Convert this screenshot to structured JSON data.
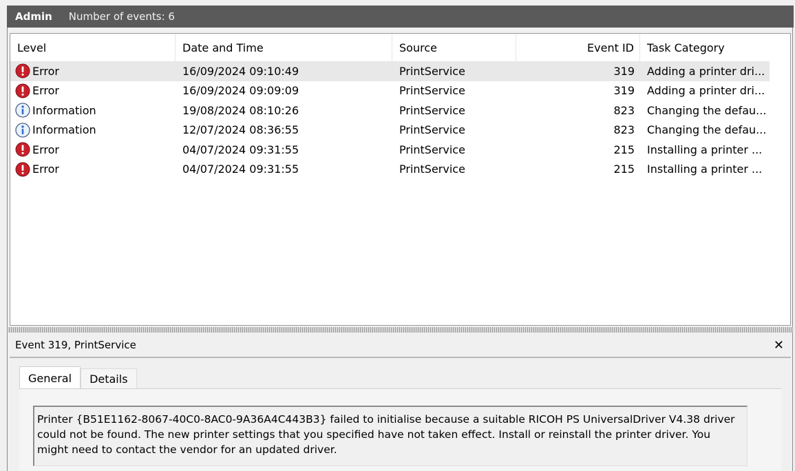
{
  "header": {
    "title": "Admin",
    "count_label": "Number of events: 6"
  },
  "columns": {
    "level": "Level",
    "date_time": "Date and Time",
    "source": "Source",
    "event_id": "Event ID",
    "task_category": "Task Category"
  },
  "events": [
    {
      "level": "Error",
      "icon": "error-icon",
      "date_time": "16/09/2024 09:10:49",
      "source": "PrintService",
      "event_id": "319",
      "task_category": "Adding a printer dri..."
    },
    {
      "level": "Error",
      "icon": "error-icon",
      "date_time": "16/09/2024 09:09:09",
      "source": "PrintService",
      "event_id": "319",
      "task_category": "Adding a printer dri..."
    },
    {
      "level": "Information",
      "icon": "information-icon",
      "date_time": "19/08/2024 08:10:26",
      "source": "PrintService",
      "event_id": "823",
      "task_category": "Changing the defau..."
    },
    {
      "level": "Information",
      "icon": "information-icon",
      "date_time": "12/07/2024 08:36:55",
      "source": "PrintService",
      "event_id": "823",
      "task_category": "Changing the defau..."
    },
    {
      "level": "Error",
      "icon": "error-icon",
      "date_time": "04/07/2024 09:31:55",
      "source": "PrintService",
      "event_id": "215",
      "task_category": "Installing a printer ..."
    },
    {
      "level": "Error",
      "icon": "error-icon",
      "date_time": "04/07/2024 09:31:55",
      "source": "PrintService",
      "event_id": "215",
      "task_category": "Installing a printer ..."
    }
  ],
  "detail": {
    "title": "Event 319, PrintService",
    "close_label": "✕",
    "tabs": [
      {
        "label": "General"
      },
      {
        "label": "Details"
      }
    ],
    "message": "Printer {B51E1162-8067-40C0-8AC0-9A36A4C443B3} failed to initialise because a suitable RICOH PS UniversalDriver V4.38 driver could not be found. The new printer settings that you specified have not taken effect. Install or reinstall the printer driver. You might need to contact the vendor for an updated driver."
  },
  "colors": {
    "title_bar": "#5a5a5a",
    "selected_row": "#e8e8e8",
    "error_red": "#c8202a",
    "info_blue": "#2a6fc9"
  }
}
